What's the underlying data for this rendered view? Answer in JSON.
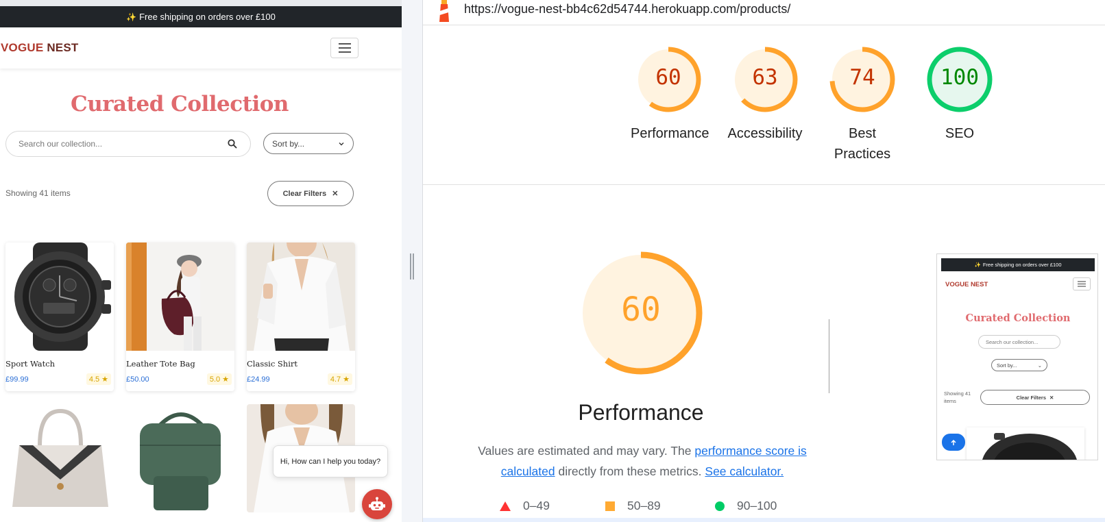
{
  "site": {
    "banner": {
      "icon": "sparkles-icon",
      "text": "Free shipping on orders over £100"
    },
    "brand": {
      "part1": "VOGUE",
      "part2": " NEST"
    },
    "title": "Curated Collection",
    "search": {
      "placeholder": "Search our collection..."
    },
    "sort": {
      "label": "Sort by..."
    },
    "results": {
      "count_text": "Showing 41 items",
      "clear_label": "Clear Filters"
    },
    "products": [
      {
        "name": "Sport Watch",
        "price": "£99.99",
        "rating": "4.5"
      },
      {
        "name": "Leather Tote Bag",
        "price": "£50.00",
        "rating": "5.0"
      },
      {
        "name": "Classic Shirt",
        "price": "£24.99",
        "rating": "4.7"
      }
    ],
    "chat": {
      "greeting": "Hi, How can I help you today?"
    }
  },
  "lighthouse": {
    "url": "https://vogue-nest-bb4c62d54744.herokuapp.com/products/",
    "scores": [
      {
        "value": "60",
        "label_line1": "Performance",
        "label_line2": ""
      },
      {
        "value": "63",
        "label_line1": "Accessibility",
        "label_line2": ""
      },
      {
        "value": "74",
        "label_line1": "Best",
        "label_line2": "Practices"
      },
      {
        "value": "100",
        "label_line1": "SEO",
        "label_line2": ""
      }
    ],
    "performance": {
      "score": "60",
      "title": "Performance",
      "desc_prefix": "Values are estimated and may vary. The ",
      "link1": "performance score is calculated",
      "desc_mid": " directly from these metrics. ",
      "link2": "See calculator."
    },
    "legend": [
      {
        "range": "0–49",
        "color": "#ff3333"
      },
      {
        "range": "50–89",
        "color": "#ffaa33"
      },
      {
        "range": "90–100",
        "color": "#00cc66"
      }
    ],
    "screenshot": {
      "banner": "Free shipping on orders over £100",
      "brand": "VOGUE NEST",
      "title": "Curated Collection",
      "search": "Search our collection...",
      "sort": "Sort by...",
      "showing": "Showing 41 items",
      "clear": "Clear Filters"
    }
  },
  "colors": {
    "average_fill": "#fff3e0",
    "average_stroke": "#ffa22b",
    "average_text_small": "#c33300",
    "average_text_large": "#ffa22b",
    "pass_fill": "#e6f7ee",
    "pass_stroke": "#0cce6b",
    "pass_text": "#008800"
  }
}
